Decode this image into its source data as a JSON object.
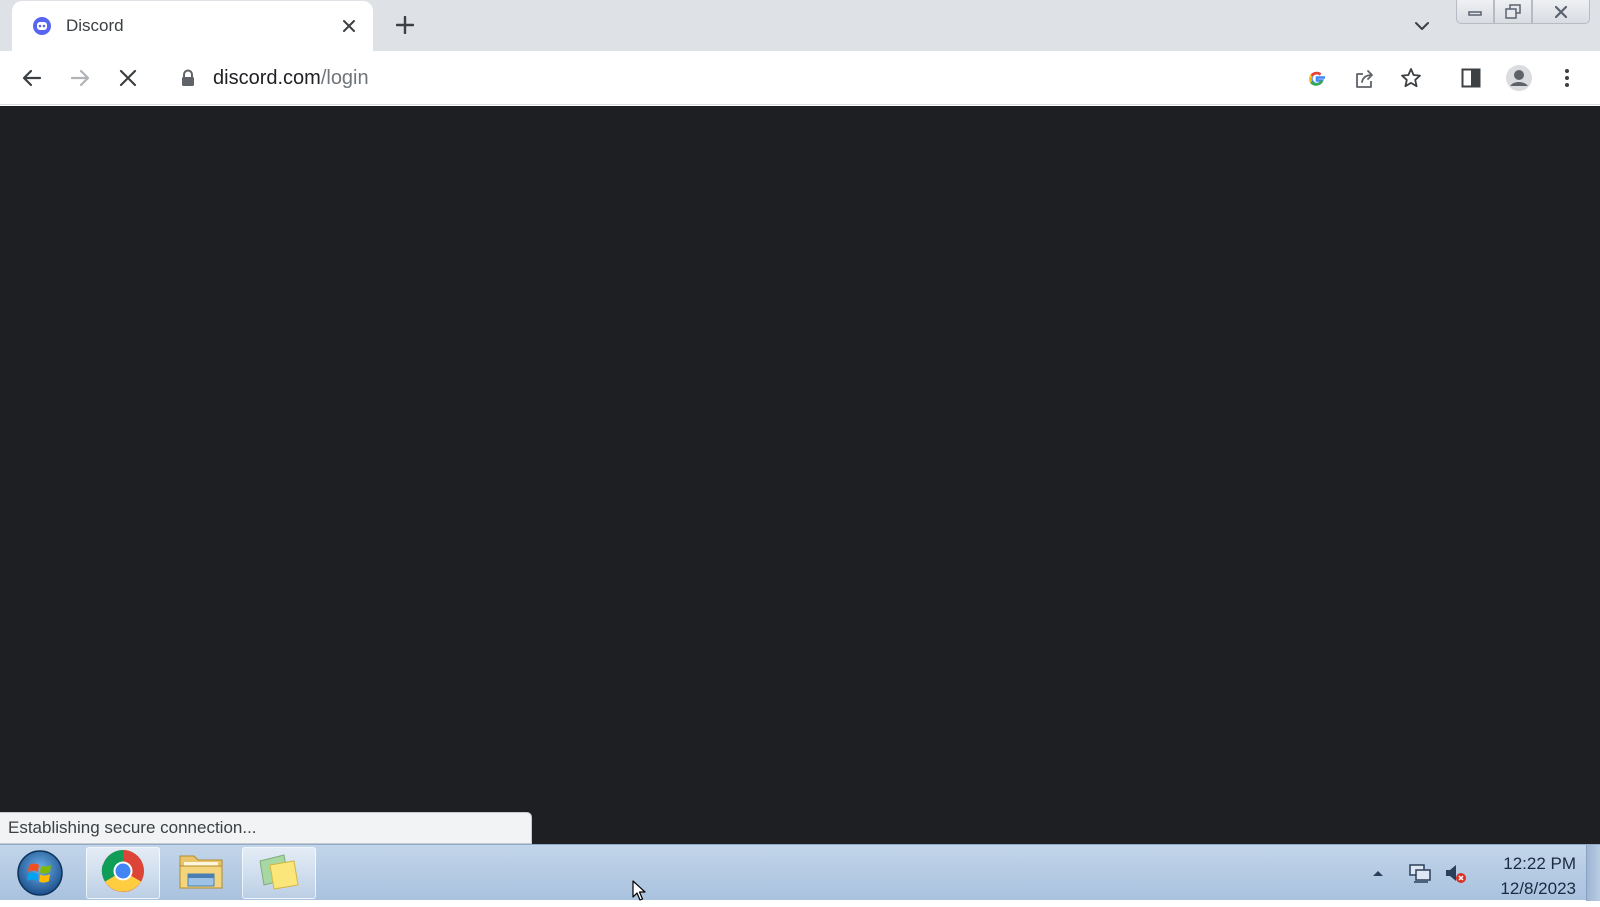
{
  "browser": {
    "tab": {
      "title": "Discord",
      "favicon": "discord-icon",
      "close_icon": "close-icon"
    },
    "new_tab_icon": "plus-icon",
    "tab_search_icon": "chevron-down-icon",
    "window_controls": [
      "minimize-icon",
      "restore-icon",
      "close-icon"
    ],
    "toolbar": {
      "back_icon": "back-arrow-icon",
      "forward_icon": "forward-arrow-icon",
      "stop_icon": "stop-loading-icon",
      "url_host": "discord.com",
      "url_path": "/login",
      "right_icons": [
        "google-icon",
        "share-icon",
        "bookmark-star-icon",
        "side-panel-icon",
        "profile-icon",
        "menu-icon"
      ]
    },
    "content_bg": "#1e1f22",
    "status_text": "Establishing secure connection..."
  },
  "taskbar": {
    "start_icon": "windows-start-icon",
    "apps": [
      {
        "name": "chrome-icon",
        "active": true
      },
      {
        "name": "file-explorer-icon",
        "active": false
      },
      {
        "name": "sticky-notes-icon",
        "active": true
      }
    ],
    "tray_icons": [
      "tray-expand-icon",
      "network-icon",
      "volume-muted-icon"
    ],
    "clock_time": "12:22 PM",
    "clock_date": "12/8/2023"
  }
}
